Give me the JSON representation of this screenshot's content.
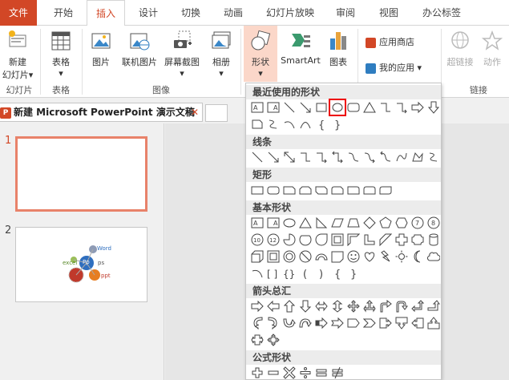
{
  "tabs": {
    "file": "文件",
    "home": "开始",
    "insert": "插入",
    "design": "设计",
    "transitions": "切换",
    "animations": "动画",
    "slideshow": "幻灯片放映",
    "review": "审阅",
    "view": "视图",
    "office_tab": "办公标签"
  },
  "ribbon": {
    "new_slide": "新建",
    "new_slide2": "幻灯片",
    "table": "表格",
    "picture": "图片",
    "online_picture": "联机图片",
    "screenshot": "屏幕截图",
    "album": "相册",
    "shapes": "形状",
    "smartart": "SmartArt",
    "chart": "图表",
    "store": "应用商店",
    "my_apps": "我的应用",
    "hyperlink": "超链接",
    "action": "动作",
    "group_slides": "幻灯片",
    "group_table": "表格",
    "group_images": "图像",
    "group_links": "链接"
  },
  "document": {
    "title": "新建 Microsoft PowerPoint 演示文稿",
    "close": "✕",
    "pp_icon_letter": "P"
  },
  "slides": {
    "n1": "1",
    "n2": "2",
    "thumb2_labels": {
      "word": "Word",
      "ps": "ps",
      "excel": "excel",
      "ppt": "ppt",
      "pp": "Pp"
    }
  },
  "shapes_menu": {
    "recent": "最近使用的形状",
    "lines": "线条",
    "rect": "矩形",
    "basic": "基本形状",
    "arrows": "箭头总汇",
    "equation": "公式形状",
    "highlighted_shape": "oval-icon"
  },
  "colors": {
    "accent": "#d24726",
    "highlight": "#e00000",
    "shape_button_bg": "#fbd7c9"
  }
}
